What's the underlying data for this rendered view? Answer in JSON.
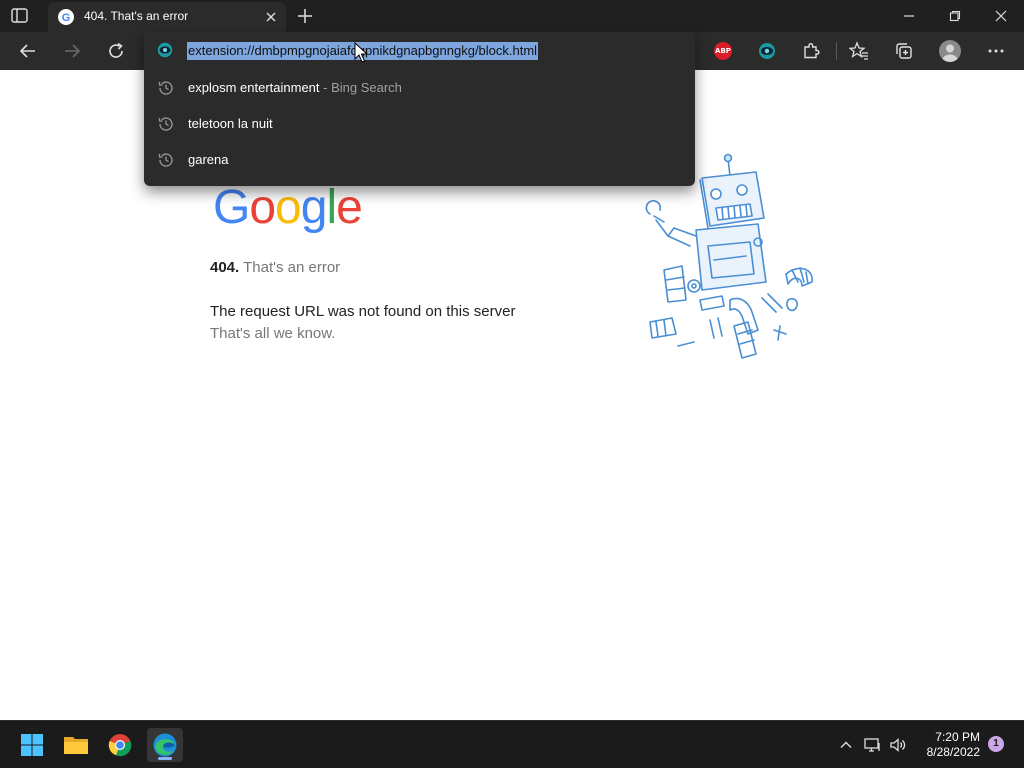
{
  "tab": {
    "title": "404. That's an error"
  },
  "address_bar": {
    "url": "extension://dmbpmpgnojaiafdgpnikdgnapbgnngkg/block.html"
  },
  "suggestions": [
    {
      "text": "explosm entertainment",
      "suffix": " - Bing Search"
    },
    {
      "text": "teletoon la nuit",
      "suffix": ""
    },
    {
      "text": "garena",
      "suffix": ""
    }
  ],
  "toolbar": {
    "abp_label": "ABP"
  },
  "page": {
    "logo_letters": [
      "G",
      "o",
      "o",
      "g",
      "l",
      "e"
    ],
    "logo_colors": [
      "#4285F4",
      "#EA4335",
      "#FBBC05",
      "#4285F4",
      "#34A853",
      "#EA4335"
    ],
    "error_code": "404.",
    "error_text": "That's an error",
    "message_line1": "The request URL was not found on this server",
    "message_line2": "That's all we know."
  },
  "taskbar": {
    "time": "7:20 PM",
    "date": "8/28/2022",
    "notification_count": "1"
  },
  "colors": {
    "titlebar_bg": "#202020",
    "toolbar_bg": "#2b2b2b",
    "selection": "#7ea6de",
    "taskbar_bg": "#1b1b1b"
  }
}
